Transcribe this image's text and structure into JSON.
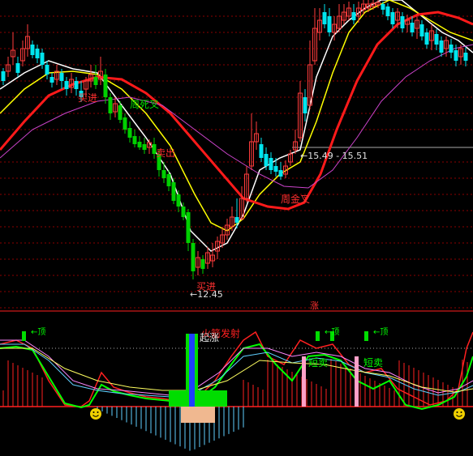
{
  "colors": {
    "background": "#000000",
    "up": "#ff3c3c",
    "down_fill": "#00e5ee",
    "down_green": "#00d000",
    "grid": "#8b0000",
    "ma_white": "#ffffff",
    "ma_yellow": "#ffff00",
    "ma_red": "#ff1a1a",
    "ma_magenta": "#cc44cc",
    "text_red": "#ff3030",
    "text_green": "#00e000",
    "text_white": "#e0e0e0",
    "osc_green": "#00ff00",
    "osc_red": "#ff2020",
    "osc_pink": "#ff88ff",
    "osc_cyan": "#60d0ff",
    "osc_yellow": "#ffff60",
    "bar_blue": "#1e40ff",
    "bar_green": "#00dd00",
    "bar_peach": "#f0b890",
    "bar_pink": "#ffa0c8",
    "smiley": "#f0d000"
  },
  "chart_data": [
    {
      "type": "candlestick",
      "panel": "price",
      "annotations": {
        "high_marker": "←15.49 - 15.51",
        "low_marker": "←12.45",
        "signals": [
          "买进",
          "周死叉",
          "卖出",
          "买进",
          "周金叉"
        ]
      },
      "price_ticks": {
        "high": "15.49",
        "low": "12.45"
      }
    },
    {
      "type": "indicator",
      "panel": "oscillator",
      "labels": {
        "zhang": "涨",
        "rocket": "火箭发射",
        "begin": "起涨",
        "short_sell1": "短卖",
        "short_sell2": "短卖",
        "signal_tag": "←顶"
      }
    }
  ]
}
